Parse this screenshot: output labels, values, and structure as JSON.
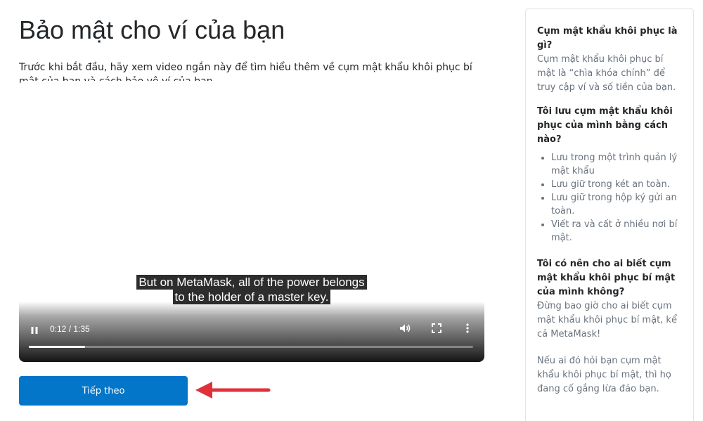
{
  "page": {
    "title": "Bảo mật cho ví của bạn",
    "intro": "Trước khi bắt đầu, hãy xem video ngắn này để tìm hiểu thêm về cụm mật khẩu khôi phục bí mật của bạn và cách bảo vệ ví của bạn."
  },
  "video": {
    "caption_line_1": "But on MetaMask, all of the power belongs",
    "caption_line_2": "to the holder of a master key.",
    "time": "0:12 / 1:35",
    "progress": 0.126,
    "icons": [
      "pause-icon",
      "volume-icon",
      "fullscreen-icon",
      "more-options-icon"
    ]
  },
  "actions": {
    "next_label": "Tiếp theo"
  },
  "sidebar": {
    "q1": "Cụm mật khẩu khôi phục là gì?",
    "a1": "Cụm mật khẩu khôi phục bí mật là “chìa khóa chính” để truy cập ví và số tiền của bạn.",
    "q2": "Tôi lưu cụm mật khẩu khôi phục của mình bằng cách nào?",
    "list": [
      "Lưu trong một trình quản lý mật khẩu",
      "Lưu giữ trong két an toàn.",
      "Lưu giữ trong hộp ký gửi an toàn.",
      "Viết ra và cất ở nhiều nơi bí mật."
    ],
    "q3": "Tôi có nên cho ai biết cụm mật khẩu khôi phục bí mật của mình không?",
    "a3": "Đừng bao giờ cho ai biết cụm mật khẩu khôi phục bí mật, kể cả MetaMask!",
    "a4": "Nếu ai đó hỏi bạn cụm mật khẩu khôi phục bí mật, thì họ đang cố gắng lừa đảo bạn."
  },
  "colors": {
    "primary": "#0376c9",
    "annotation_arrow": "#e0313a",
    "muted_text": "#6a737d"
  }
}
